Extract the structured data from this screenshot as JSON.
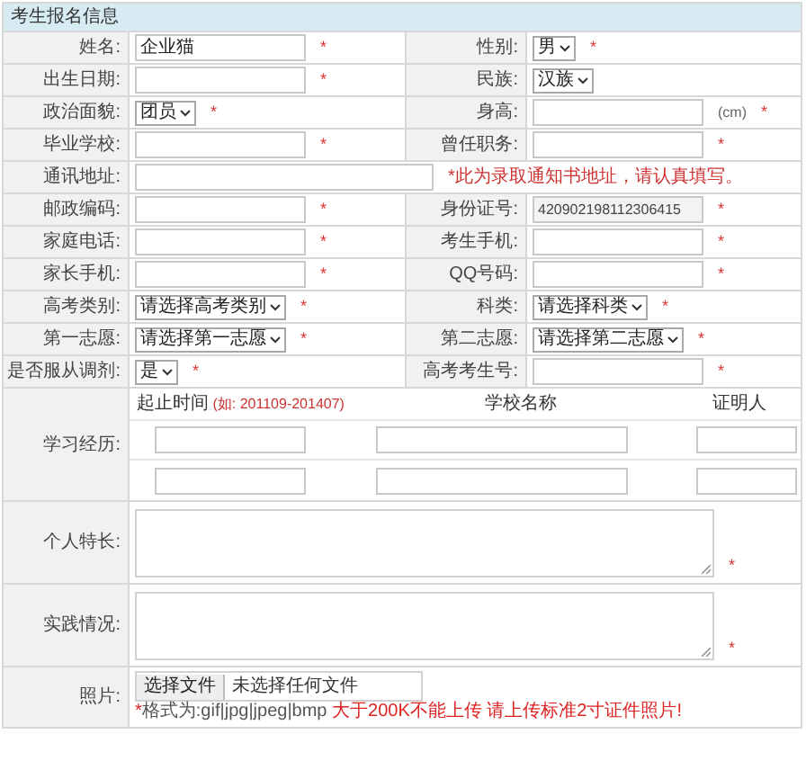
{
  "section_title": "考生报名信息",
  "rows": [
    {
      "cells": [
        {
          "label": "姓名:",
          "field": {
            "kind": "input",
            "value": "企业猫",
            "mark": "*"
          }
        },
        {
          "label": "性别:",
          "field": {
            "kind": "select",
            "value": "男",
            "mark": "*"
          }
        }
      ]
    },
    {
      "cells": [
        {
          "label": "出生日期:",
          "field": {
            "kind": "input",
            "mark": "*"
          }
        },
        {
          "label": "民族:",
          "field": {
            "kind": "select",
            "value": "汉族"
          }
        }
      ]
    },
    {
      "cells": [
        {
          "label": "政治面貌:",
          "field": {
            "kind": "select",
            "value": "团员",
            "mark": "*"
          }
        },
        {
          "label": "身高:",
          "field": {
            "kind": "input",
            "unit": "(cm)",
            "mark": "*"
          }
        }
      ]
    },
    {
      "cells": [
        {
          "label": "毕业学校:",
          "field": {
            "kind": "input",
            "mark": "*"
          }
        },
        {
          "label": "曾任职务:",
          "field": {
            "kind": "input",
            "mark": "*"
          }
        }
      ]
    },
    {
      "cells": [
        {
          "label": "通讯地址:",
          "field": {
            "kind": "input",
            "wide": true,
            "note": "*此为录取通知书地址，请认真填写。"
          }
        }
      ]
    },
    {
      "cells": [
        {
          "label": "邮政编码:",
          "field": {
            "kind": "input",
            "mark": "*"
          }
        },
        {
          "label": "身份证号:",
          "field": {
            "kind": "input",
            "value": "420902198112306415",
            "readonly": true,
            "mark": "*"
          }
        }
      ]
    },
    {
      "cells": [
        {
          "label": "家庭电话:",
          "field": {
            "kind": "input",
            "mark": "*"
          }
        },
        {
          "label": "考生手机:",
          "field": {
            "kind": "input",
            "mark": "*"
          }
        }
      ]
    },
    {
      "cells": [
        {
          "label": "家长手机:",
          "field": {
            "kind": "input",
            "mark": "*"
          }
        },
        {
          "label": "QQ号码:",
          "field": {
            "kind": "input",
            "mark": "*"
          }
        }
      ]
    },
    {
      "cells": [
        {
          "label": "高考类别:",
          "field": {
            "kind": "select",
            "value": "请选择高考类别",
            "mark": "*"
          }
        },
        {
          "label": "科类:",
          "field": {
            "kind": "select",
            "value": "请选择科类",
            "mark": "*"
          }
        }
      ]
    },
    {
      "cells": [
        {
          "label": "第一志愿:",
          "field": {
            "kind": "select",
            "value": "请选择第一志愿",
            "mark": "*"
          }
        },
        {
          "label": "第二志愿:",
          "field": {
            "kind": "select",
            "value": "请选择第二志愿",
            "mark": "*"
          }
        }
      ]
    },
    {
      "cells": [
        {
          "label": "是否服从调剂:",
          "field": {
            "kind": "select",
            "value": "是",
            "mark": "*"
          }
        },
        {
          "label": "高考考生号:",
          "field": {
            "kind": "input",
            "mark": "*"
          }
        }
      ]
    }
  ],
  "study": {
    "label": "学习经历:",
    "columns": [
      {
        "title": "起止时间",
        "hint": "(如: 201109-201407)"
      },
      {
        "title": "学校名称"
      },
      {
        "title": "证明人"
      }
    ],
    "entries": [
      {
        "kind": "blank"
      },
      {
        "kind": "blank"
      }
    ]
  },
  "textareas": [
    {
      "label": "个人特长:",
      "mark": "*"
    },
    {
      "label": "实践情况:",
      "mark": "*"
    }
  ],
  "photo": {
    "label": "照片:",
    "button": "选择文件",
    "status": "未选择任何文件",
    "hint": [
      {
        "text": "*",
        "kind": "alert"
      },
      {
        "text": "格式为:gif|jpg|jpeg|bmp ",
        "kind": "plain"
      },
      {
        "text": "大于200K不能上传 请上传标准2寸证件照片!",
        "kind": "alert"
      }
    ]
  }
}
